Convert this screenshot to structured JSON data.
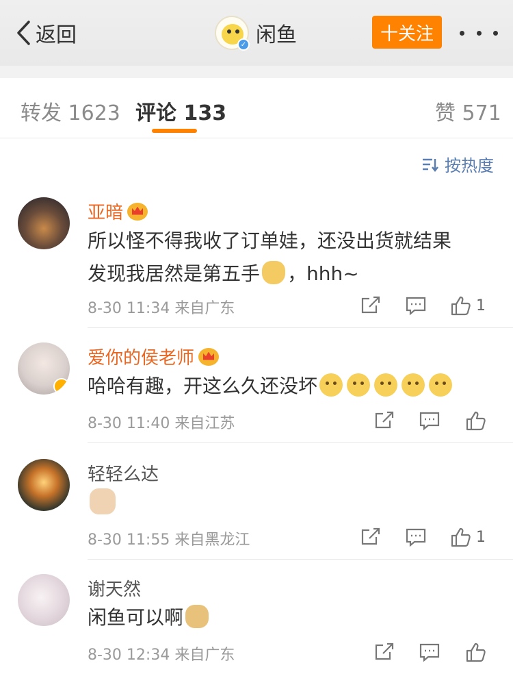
{
  "nav": {
    "back_label": "返回",
    "title": "闲鱼",
    "follow_label": "十关注"
  },
  "tabs": {
    "repost": "转发 1623",
    "comments": "评论 133",
    "likes": "赞 571"
  },
  "sort_label": "按热度",
  "colors": {
    "accent": "#ff8200",
    "vip_name": "#e86722",
    "link": "#5a7eb0"
  },
  "comments": [
    {
      "name": "亚暗",
      "vip": true,
      "text_line1": "所以怪不得我收了订单娃，还没出货就结果",
      "text_line2_a": "发现我居然是第五手",
      "text_line2_b": "，hhh~",
      "emoji": "sweat-laugh-emoji",
      "meta": "8-30 11:34  来自广东",
      "likes": "1"
    },
    {
      "name": "爱你的侯老师",
      "vip": true,
      "text": "哈哈有趣，开这么久还没坏",
      "emoji": "thinking-emoji x5",
      "meta": "8-30 11:40  来自江苏",
      "likes": ""
    },
    {
      "name": "轻轻么达",
      "vip": false,
      "text": "",
      "emoji": "cat-emoji",
      "meta": "8-30 11:55  来自黑龙江",
      "likes": "1"
    },
    {
      "name": "谢天然",
      "vip": false,
      "text": "闲鱼可以啊",
      "emoji": "doge-emoji",
      "meta": "8-30 12:34  来自广东",
      "likes": ""
    }
  ]
}
